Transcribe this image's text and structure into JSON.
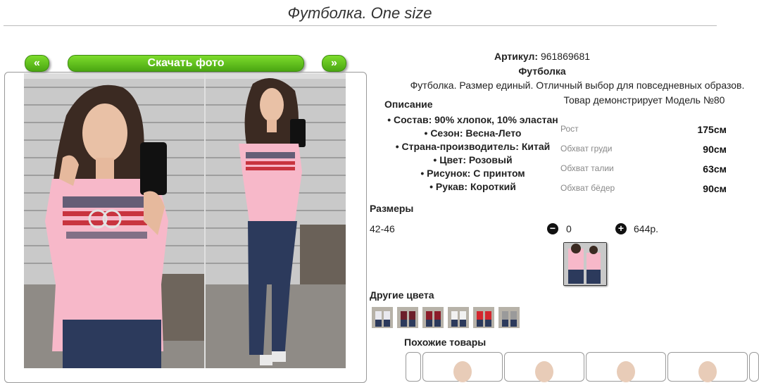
{
  "page": {
    "title": "Футболка. One size"
  },
  "gallery": {
    "prev_label": "«",
    "next_label": "»",
    "download_label": "Скачать фото"
  },
  "product": {
    "article_label": "Артикул:",
    "article_value": "961869681",
    "name": "Футболка",
    "description": "Футболка. Размер единый. Отличный выбор для повседневных образов.",
    "model_note": "Товар демонстрирует Модель №80",
    "desc_heading": "Описание",
    "attributes": [
      "• Состав: 90% хлопок, 10% эластан",
      "• Сезон: Весна-Лето",
      "• Страна-производитель: Китай",
      "• Цвет: Розовый",
      "• Рисунок: С принтом",
      "• Рукав: Короткий"
    ]
  },
  "measurements": [
    {
      "label": "Рост",
      "value": "175см"
    },
    {
      "label": "Обхват груди",
      "value": "90см"
    },
    {
      "label": "Обхват талии",
      "value": "63см"
    },
    {
      "label": "Обхват бёдер",
      "value": "90см"
    }
  ],
  "sizes": {
    "heading": "Размеры",
    "rows": [
      {
        "label": "42-46",
        "quantity": "0",
        "price": "644р."
      }
    ]
  },
  "other_colors": {
    "heading": "Другие цвета",
    "count": 6
  },
  "similar": {
    "heading": "Похожие товары"
  },
  "colors": {
    "accent_green": "#5cbf1a",
    "shirt_pink": "#f7b8c9",
    "jeans": "#2c3a5c"
  },
  "icons": [
    "minus-icon",
    "plus-icon"
  ]
}
